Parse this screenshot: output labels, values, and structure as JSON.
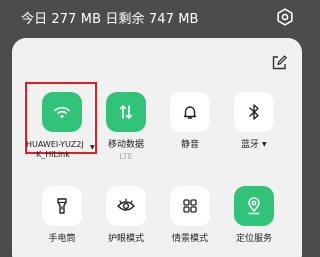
{
  "status_bar": {
    "data_usage": "今日 277 MB 日剩余 747 MB",
    "settings_icon": "settings-gear-icon"
  },
  "panel": {
    "edit_icon": "edit-pencil-icon",
    "tiles": [
      {
        "label_line1": "HUAWEI-YUZ2J",
        "label_line2": "K_HiLink",
        "icon": "wifi-icon",
        "active": true,
        "has_dropdown": true
      },
      {
        "label": "移动数据",
        "sublabel": "LTE",
        "icon": "mobile-data-icon",
        "active": true
      },
      {
        "label": "静音",
        "icon": "bell-icon",
        "active": false
      },
      {
        "label": "蓝牙",
        "icon": "bluetooth-icon",
        "active": false,
        "has_dropdown": true
      },
      {
        "label": "手电筒",
        "icon": "flashlight-icon",
        "active": false
      },
      {
        "label": "护眼模式",
        "icon": "eye-comfort-icon",
        "active": false
      },
      {
        "label": "情景模式",
        "icon": "scene-mode-icon",
        "active": false
      },
      {
        "label": "定位服务",
        "icon": "location-icon",
        "active": true
      }
    ]
  },
  "colors": {
    "active_tile": "#32c37a",
    "inactive_tile": "#ffffff",
    "panel_bg": "#f1f1f1",
    "backdrop": "#4c4c4c",
    "highlight": "#e02020"
  }
}
